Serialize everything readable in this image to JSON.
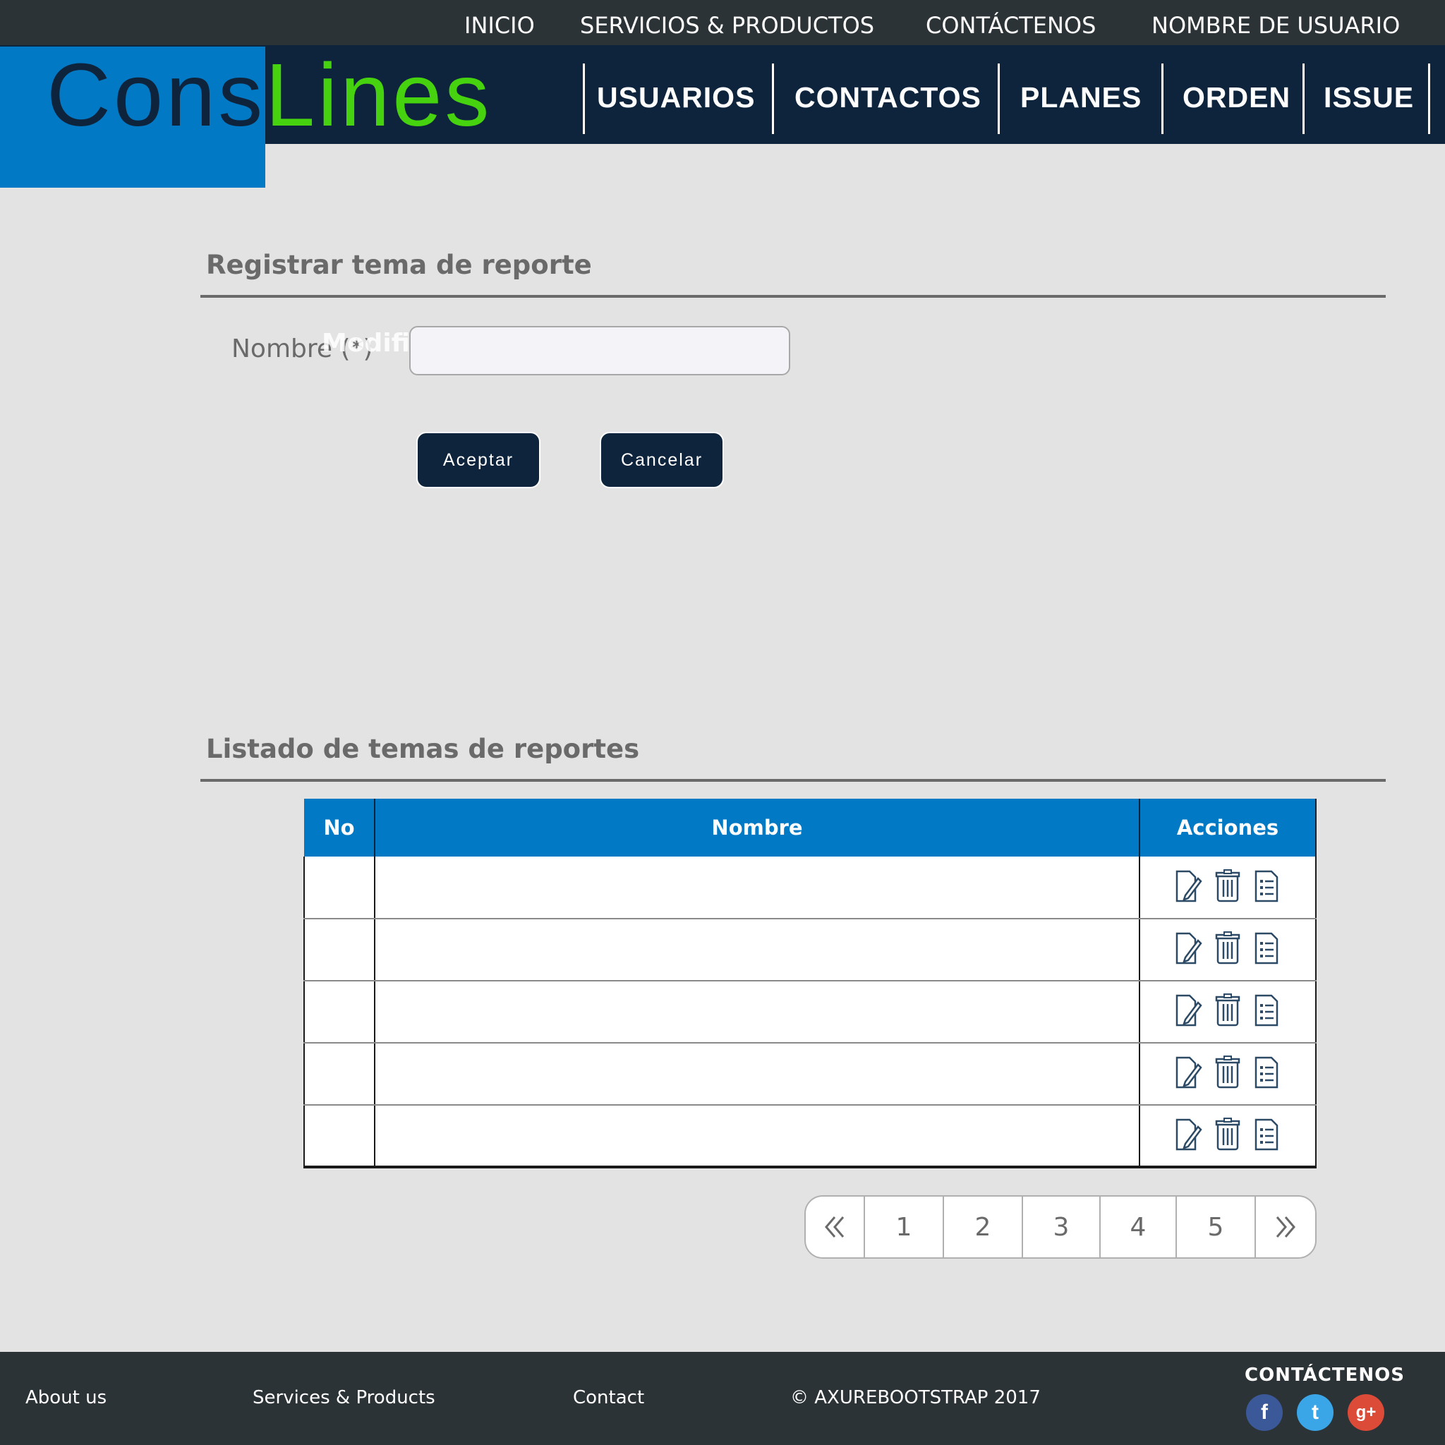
{
  "topbar": {
    "links": [
      "INICIO",
      "SERVICIOS & PRODUCTOS",
      "CONTÁCTENOS",
      "NOMBRE DE USUARIO"
    ]
  },
  "logo": {
    "part1": "Cons",
    "part2": "Lines"
  },
  "nav": {
    "items": [
      "USUARIOS",
      "CONTACTOS",
      "PLANES",
      "ORDEN",
      "ISSUE"
    ]
  },
  "form": {
    "title": "Registrar tema de reporte",
    "name_label": "Nombre (*)",
    "ghost_text": "Modificar usuarios",
    "name_value": "",
    "accept_label": "Aceptar",
    "cancel_label": "Cancelar"
  },
  "list": {
    "title": "Listado de temas de reportes",
    "columns": [
      "No",
      "Nombre",
      "Acciones"
    ],
    "rows": [
      {
        "no": "",
        "nombre": "",
        "actions": [
          "edit-icon",
          "trash-icon",
          "details-icon"
        ]
      },
      {
        "no": "",
        "nombre": "",
        "actions": [
          "edit-icon",
          "trash-icon",
          "details-icon"
        ]
      },
      {
        "no": "",
        "nombre": "",
        "actions": [
          "edit-icon",
          "trash-icon",
          "details-icon"
        ]
      },
      {
        "no": "",
        "nombre": "",
        "actions": [
          "edit-icon",
          "trash-icon",
          "details-icon"
        ]
      },
      {
        "no": "",
        "nombre": "",
        "actions": [
          "edit-icon",
          "trash-icon",
          "details-icon"
        ]
      }
    ]
  },
  "pagination": {
    "prev_icon": "double-chevron-left-icon",
    "pages": [
      "1",
      "2",
      "3",
      "4",
      "5"
    ],
    "next_icon": "double-chevron-right-icon"
  },
  "footer": {
    "links": [
      "About us",
      "Services & Products",
      "Contact"
    ],
    "copyright": "© AXUREBOOTSTRAP 2017",
    "contact_title": "CONTÁCTENOS",
    "social": [
      {
        "icon": "facebook-icon",
        "glyph": "f",
        "color": "#3b5998"
      },
      {
        "icon": "twitter-icon",
        "glyph": "t",
        "color": "#3aa6e8"
      },
      {
        "icon": "google-plus-icon",
        "glyph": "g+",
        "color": "#dc4a38"
      }
    ]
  },
  "colors": {
    "navy": "#0e243c",
    "brand_blue": "#0279c4",
    "brand_green": "#47d20f",
    "dark_bar": "#2c3337",
    "page_bg": "#e3e3e3"
  }
}
